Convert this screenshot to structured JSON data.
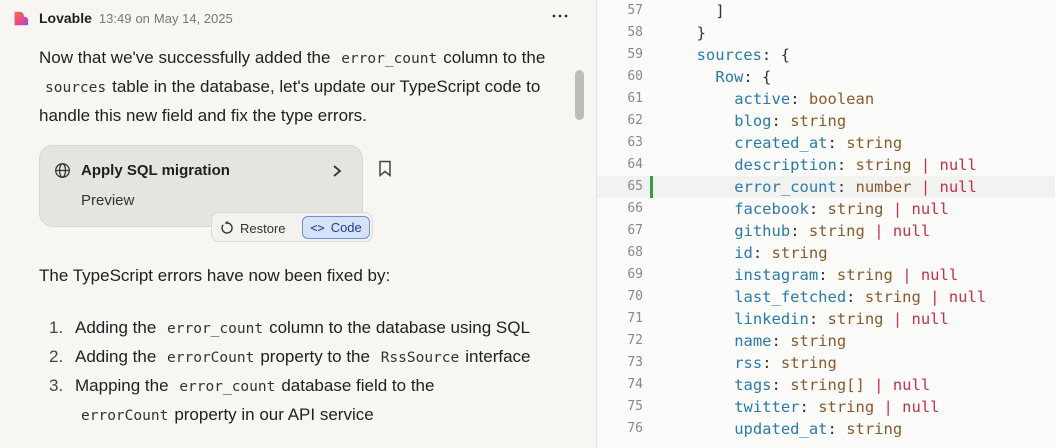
{
  "message": {
    "author": "Lovable",
    "time": "13:49",
    "date_prefix": "on",
    "date": "May 14, 2025",
    "intro": [
      {
        "type": "text",
        "text": "Now that we've successfully added the"
      },
      {
        "type": "code",
        "text": "error_count"
      },
      {
        "type": "text",
        "text": "column to the"
      },
      {
        "type": "code",
        "text": "sources"
      },
      {
        "type": "text",
        "text": "table in the database, let's update our TypeScript code to handle this new field and fix the type errors."
      }
    ],
    "action_card": {
      "title": "Apply SQL migration",
      "subtitle": "Preview"
    },
    "toolbar": {
      "restore_label": "Restore",
      "code_label": "Code"
    },
    "summary": "The TypeScript errors have now been fixed by:",
    "steps": [
      {
        "num": "1.",
        "parts": [
          {
            "type": "text",
            "text": "Adding the"
          },
          {
            "type": "code",
            "text": "error_count"
          },
          {
            "type": "text",
            "text": "column to the database using SQL"
          }
        ]
      },
      {
        "num": "2.",
        "parts": [
          {
            "type": "text",
            "text": "Adding the"
          },
          {
            "type": "code",
            "text": "errorCount"
          },
          {
            "type": "text",
            "text": "property to the"
          },
          {
            "type": "code",
            "text": "RssSource"
          },
          {
            "type": "text",
            "text": "interface"
          }
        ]
      },
      {
        "num": "3.",
        "parts": [
          {
            "type": "text",
            "text": "Mapping the"
          },
          {
            "type": "code",
            "text": "error_count"
          },
          {
            "type": "text",
            "text": "database field to the"
          },
          {
            "type": "code",
            "text": "errorCount"
          },
          {
            "type": "text",
            "text": "property in our API service"
          }
        ]
      }
    ]
  },
  "editor": {
    "active_line": "65",
    "lines": [
      {
        "n": "57",
        "indent": 6,
        "tokens": [
          {
            "c": "pn",
            "t": "]"
          }
        ]
      },
      {
        "n": "58",
        "indent": 4,
        "tokens": [
          {
            "c": "pn",
            "t": "}"
          }
        ]
      },
      {
        "n": "59",
        "indent": 4,
        "tokens": [
          {
            "c": "k",
            "t": "sources"
          },
          {
            "c": "pn",
            "t": ": {"
          }
        ]
      },
      {
        "n": "60",
        "indent": 6,
        "tokens": [
          {
            "c": "k",
            "t": "Row"
          },
          {
            "c": "pn",
            "t": ": {"
          }
        ]
      },
      {
        "n": "61",
        "indent": 8,
        "tokens": [
          {
            "c": "k",
            "t": "active"
          },
          {
            "c": "pn",
            "t": ": "
          },
          {
            "c": "t",
            "t": "boolean"
          }
        ]
      },
      {
        "n": "62",
        "indent": 8,
        "tokens": [
          {
            "c": "k",
            "t": "blog"
          },
          {
            "c": "pn",
            "t": ": "
          },
          {
            "c": "t",
            "t": "string"
          }
        ]
      },
      {
        "n": "63",
        "indent": 8,
        "tokens": [
          {
            "c": "k",
            "t": "created_at"
          },
          {
            "c": "pn",
            "t": ": "
          },
          {
            "c": "t",
            "t": "string"
          }
        ]
      },
      {
        "n": "64",
        "indent": 8,
        "tokens": [
          {
            "c": "k",
            "t": "description"
          },
          {
            "c": "pn",
            "t": ": "
          },
          {
            "c": "t",
            "t": "string"
          },
          {
            "c": "n",
            "t": " | null"
          }
        ]
      },
      {
        "n": "65",
        "indent": 8,
        "tokens": [
          {
            "c": "k",
            "t": "error_count"
          },
          {
            "c": "pn",
            "t": ": "
          },
          {
            "c": "t",
            "t": "number"
          },
          {
            "c": "n",
            "t": " | null"
          }
        ]
      },
      {
        "n": "66",
        "indent": 8,
        "tokens": [
          {
            "c": "k",
            "t": "facebook"
          },
          {
            "c": "pn",
            "t": ": "
          },
          {
            "c": "t",
            "t": "string"
          },
          {
            "c": "n",
            "t": " | null"
          }
        ]
      },
      {
        "n": "67",
        "indent": 8,
        "tokens": [
          {
            "c": "k",
            "t": "github"
          },
          {
            "c": "pn",
            "t": ": "
          },
          {
            "c": "t",
            "t": "string"
          },
          {
            "c": "n",
            "t": " | null"
          }
        ]
      },
      {
        "n": "68",
        "indent": 8,
        "tokens": [
          {
            "c": "k",
            "t": "id"
          },
          {
            "c": "pn",
            "t": ": "
          },
          {
            "c": "t",
            "t": "string"
          }
        ]
      },
      {
        "n": "69",
        "indent": 8,
        "tokens": [
          {
            "c": "k",
            "t": "instagram"
          },
          {
            "c": "pn",
            "t": ": "
          },
          {
            "c": "t",
            "t": "string"
          },
          {
            "c": "n",
            "t": " | null"
          }
        ]
      },
      {
        "n": "70",
        "indent": 8,
        "tokens": [
          {
            "c": "k",
            "t": "last_fetched"
          },
          {
            "c": "pn",
            "t": ": "
          },
          {
            "c": "t",
            "t": "string"
          },
          {
            "c": "n",
            "t": " | null"
          }
        ]
      },
      {
        "n": "71",
        "indent": 8,
        "tokens": [
          {
            "c": "k",
            "t": "linkedin"
          },
          {
            "c": "pn",
            "t": ": "
          },
          {
            "c": "t",
            "t": "string"
          },
          {
            "c": "n",
            "t": " | null"
          }
        ]
      },
      {
        "n": "72",
        "indent": 8,
        "tokens": [
          {
            "c": "k",
            "t": "name"
          },
          {
            "c": "pn",
            "t": ": "
          },
          {
            "c": "t",
            "t": "string"
          }
        ]
      },
      {
        "n": "73",
        "indent": 8,
        "tokens": [
          {
            "c": "k",
            "t": "rss"
          },
          {
            "c": "pn",
            "t": ": "
          },
          {
            "c": "t",
            "t": "string"
          }
        ]
      },
      {
        "n": "74",
        "indent": 8,
        "tokens": [
          {
            "c": "k",
            "t": "tags"
          },
          {
            "c": "pn",
            "t": ": "
          },
          {
            "c": "t",
            "t": "string[]"
          },
          {
            "c": "n",
            "t": " | null"
          }
        ]
      },
      {
        "n": "75",
        "indent": 8,
        "tokens": [
          {
            "c": "k",
            "t": "twitter"
          },
          {
            "c": "pn",
            "t": ": "
          },
          {
            "c": "t",
            "t": "string"
          },
          {
            "c": "n",
            "t": " | null"
          }
        ]
      },
      {
        "n": "76",
        "indent": 8,
        "tokens": [
          {
            "c": "k",
            "t": "updated_at"
          },
          {
            "c": "pn",
            "t": ": "
          },
          {
            "c": "t",
            "t": "string"
          }
        ]
      }
    ]
  },
  "colors": {
    "logo": "#ef5a3c",
    "code_button_bg": "#d6e2f8",
    "code_button_border": "#6d8fd4",
    "active_line_marker": "#2ea043"
  },
  "icons": {
    "logo": "lovable-heart-icon",
    "more": "more-horizontal-icon",
    "card": "globe-icon",
    "card_chevron": "chevron-right-icon",
    "bookmark": "bookmark-icon",
    "restore": "restore-icon",
    "code": "code-brackets-icon"
  }
}
